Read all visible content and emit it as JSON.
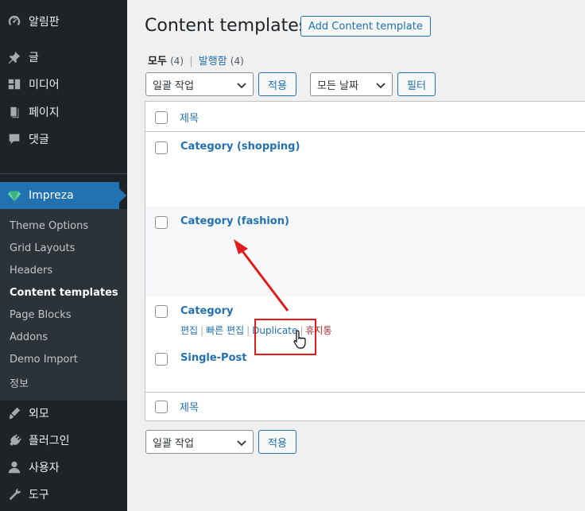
{
  "sidebar": {
    "dashboard": "알림판",
    "posts": "글",
    "media": "미디어",
    "pages": "페이지",
    "comments": "댓글",
    "impreza": "Impreza",
    "submenu": [
      "Theme Options",
      "Grid Layouts",
      "Headers",
      "Content templates",
      "Page Blocks",
      "Addons",
      "Demo Import",
      "정보"
    ],
    "appearance": "외모",
    "plugins": "플러그인",
    "users": "사용자",
    "tools": "도구"
  },
  "header": {
    "title": "Content templates",
    "add_button": "Add Content template"
  },
  "filters": {
    "all_label": "모두",
    "all_count": "(4)",
    "published_label": "발행함",
    "published_count": "(4)"
  },
  "toolbar": {
    "bulk_action": "일괄 작업",
    "apply": "적용",
    "date_filter": "모든 날짜",
    "filter": "필터"
  },
  "table": {
    "column_title": "제목",
    "rows": [
      "Category (shopping)",
      "Category (fashion)",
      "Category",
      "Single-Post"
    ],
    "row_actions": {
      "edit": "편집",
      "quick_edit": "빠른 편집",
      "duplicate": "Duplicate",
      "trash": "휴지통"
    }
  },
  "colors": {
    "sidebar_bg": "#1d2327",
    "accent": "#2271b1",
    "highlight": "#e21b1b"
  }
}
